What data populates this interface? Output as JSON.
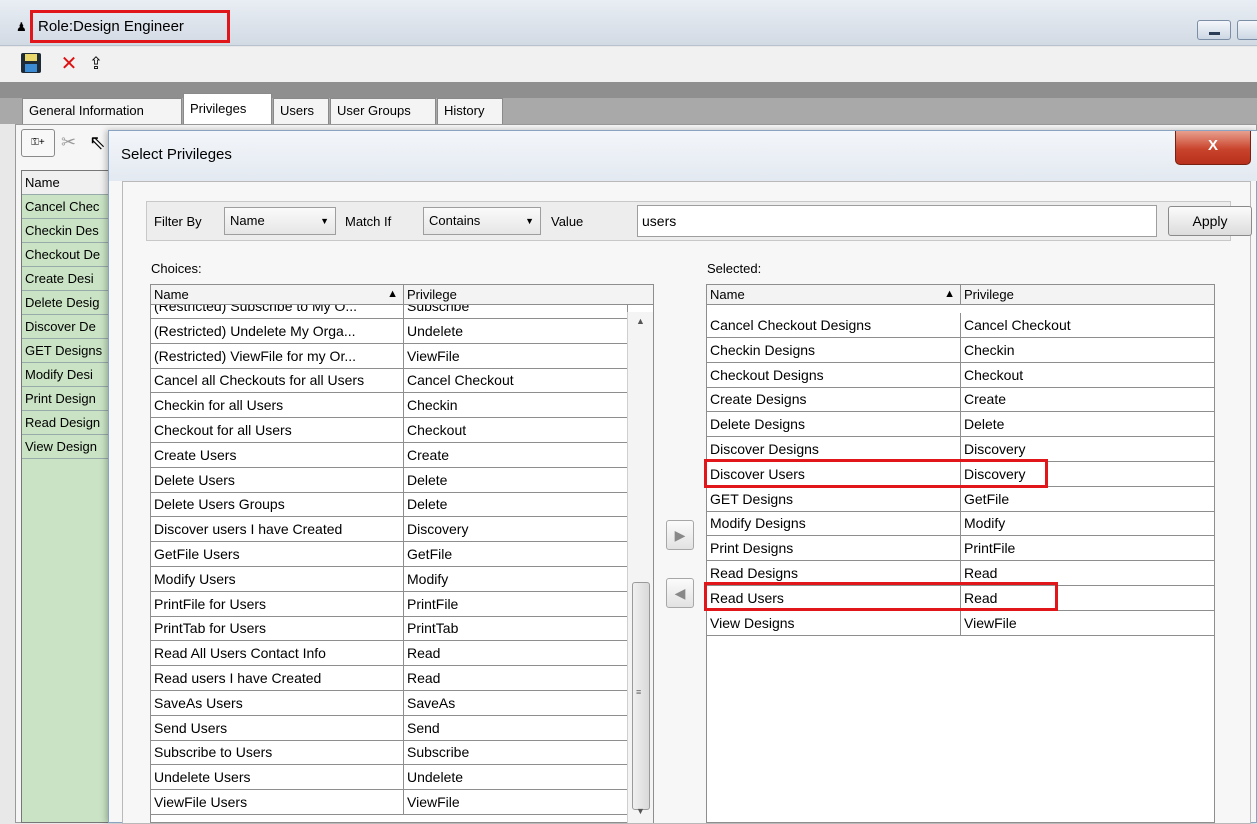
{
  "window": {
    "title": "Role:Design Engineer"
  },
  "tabs": [
    "General Information",
    "Privileges",
    "Users",
    "User Groups",
    "History"
  ],
  "active_tab": "Privileges",
  "left_list": {
    "header": "Name",
    "items": [
      "Cancel Chec",
      "Checkin Des",
      "Checkout De",
      "Create Desi",
      "Delete Desig",
      "Discover De",
      "GET Designs",
      "Modify Desi",
      "Print Design",
      "Read Design",
      "View Design"
    ]
  },
  "dialog": {
    "title": "Select Privileges",
    "close_label": "X",
    "filter": {
      "filter_by_label": "Filter By",
      "filter_by_value": "Name",
      "match_if_label": "Match If",
      "match_if_value": "Contains",
      "value_label": "Value",
      "value": "users",
      "apply_label": "Apply"
    },
    "choices": {
      "label": "Choices:",
      "columns": [
        "Name",
        "Privilege"
      ],
      "sort_indicator": "▲",
      "rows": [
        [
          "(Restricted) Subscribe to My O...",
          "Subscribe"
        ],
        [
          "(Restricted) Undelete My Orga...",
          "Undelete"
        ],
        [
          "(Restricted) ViewFile for my Or...",
          "ViewFile"
        ],
        [
          "Cancel all Checkouts for all Users",
          "Cancel Checkout"
        ],
        [
          "Checkin for all Users",
          "Checkin"
        ],
        [
          "Checkout for all Users",
          "Checkout"
        ],
        [
          "Create Users",
          "Create"
        ],
        [
          "Delete Users",
          "Delete"
        ],
        [
          "Delete Users Groups",
          "Delete"
        ],
        [
          "Discover users I have Created",
          "Discovery"
        ],
        [
          "GetFile Users",
          "GetFile"
        ],
        [
          "Modify Users",
          "Modify"
        ],
        [
          "PrintFile for Users",
          "PrintFile"
        ],
        [
          "PrintTab for Users",
          "PrintTab"
        ],
        [
          "Read All Users Contact Info",
          "Read"
        ],
        [
          "Read users I have Created",
          "Read"
        ],
        [
          "SaveAs Users",
          "SaveAs"
        ],
        [
          "Send Users",
          "Send"
        ],
        [
          "Subscribe to Users",
          "Subscribe"
        ],
        [
          "Undelete Users",
          "Undelete"
        ],
        [
          "ViewFile Users",
          "ViewFile"
        ]
      ]
    },
    "selected": {
      "label": "Selected:",
      "columns": [
        "Name",
        "Privilege"
      ],
      "sort_indicator": "▲",
      "rows": [
        [
          "Cancel Checkout Designs",
          "Cancel Checkout"
        ],
        [
          "Checkin Designs",
          "Checkin"
        ],
        [
          "Checkout Designs",
          "Checkout"
        ],
        [
          "Create Designs",
          "Create"
        ],
        [
          "Delete Designs",
          "Delete"
        ],
        [
          "Discover Designs",
          "Discovery"
        ],
        [
          "Discover Users",
          "Discovery"
        ],
        [
          "GET Designs",
          "GetFile"
        ],
        [
          "Modify Designs",
          "Modify"
        ],
        [
          "Print Designs",
          "PrintFile"
        ],
        [
          "Read Designs",
          "Read"
        ],
        [
          "Read Users",
          "Read"
        ],
        [
          "View Designs",
          "ViewFile"
        ]
      ],
      "highlighted_rows": [
        "Discover Users",
        "Read Users"
      ]
    },
    "add_button_glyph": "▶",
    "remove_button_glyph": "◀"
  },
  "colors": {
    "highlight": "#e0161b",
    "left_list_bg": "#c9e3c4",
    "close_button": "#c9442c"
  }
}
